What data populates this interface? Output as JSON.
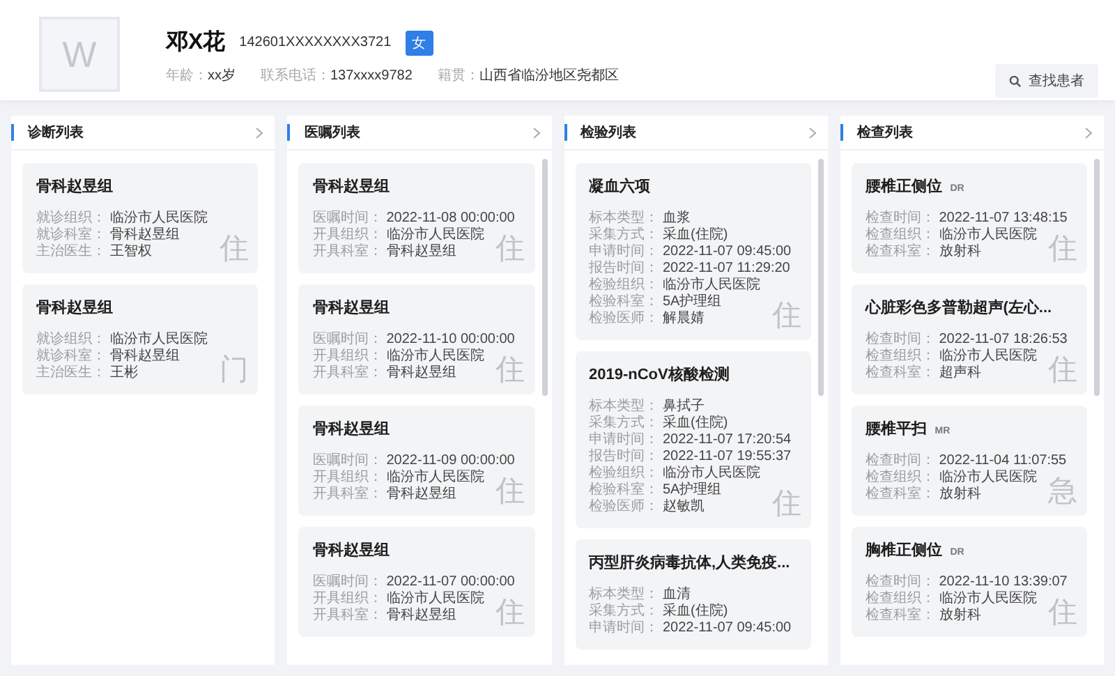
{
  "patient": {
    "avatar_letter": "W",
    "name": "邓X花",
    "id_number": "142601XXXXXXXX3721",
    "gender": "女",
    "info": [
      {
        "label": "年龄：",
        "value": "xx岁"
      },
      {
        "label": "联系电话：",
        "value": "137xxxx9782"
      },
      {
        "label": "籍贯：",
        "value": "山西省临汾地区尧都区"
      }
    ],
    "search_button": "查找患者"
  },
  "panels": [
    {
      "title": "诊断列表",
      "scrollable": false,
      "cards": [
        {
          "title": "骨科赵昱组",
          "badge": "住",
          "fields": [
            {
              "label": "就诊组织：",
              "value": "临汾市人民医院"
            },
            {
              "label": "就诊科室：",
              "value": "骨科赵昱组"
            },
            {
              "label": "主治医生：",
              "value": "王智权"
            }
          ]
        },
        {
          "title": "骨科赵昱组",
          "badge": "门",
          "fields": [
            {
              "label": "就诊组织：",
              "value": "临汾市人民医院"
            },
            {
              "label": "就诊科室：",
              "value": "骨科赵昱组"
            },
            {
              "label": "主治医生：",
              "value": "王彬"
            }
          ]
        }
      ]
    },
    {
      "title": "医嘱列表",
      "scrollable": true,
      "cards": [
        {
          "title": "骨科赵昱组",
          "badge": "住",
          "fields": [
            {
              "label": "医嘱时间：",
              "value": "2022-11-08 00:00:00"
            },
            {
              "label": "开具组织：",
              "value": "临汾市人民医院"
            },
            {
              "label": "开具科室：",
              "value": "骨科赵昱组"
            }
          ]
        },
        {
          "title": "骨科赵昱组",
          "badge": "住",
          "fields": [
            {
              "label": "医嘱时间：",
              "value": "2022-11-10 00:00:00"
            },
            {
              "label": "开具组织：",
              "value": "临汾市人民医院"
            },
            {
              "label": "开具科室：",
              "value": "骨科赵昱组"
            }
          ]
        },
        {
          "title": "骨科赵昱组",
          "badge": "住",
          "fields": [
            {
              "label": "医嘱时间：",
              "value": "2022-11-09 00:00:00"
            },
            {
              "label": "开具组织：",
              "value": "临汾市人民医院"
            },
            {
              "label": "开具科室：",
              "value": "骨科赵昱组"
            }
          ]
        },
        {
          "title": "骨科赵昱组",
          "badge": "住",
          "fields": [
            {
              "label": "医嘱时间：",
              "value": "2022-11-07 00:00:00"
            },
            {
              "label": "开具组织：",
              "value": "临汾市人民医院"
            },
            {
              "label": "开具科室：",
              "value": "骨科赵昱组"
            }
          ]
        }
      ]
    },
    {
      "title": "检验列表",
      "scrollable": true,
      "cards": [
        {
          "title": "凝血六项",
          "badge": "住",
          "fields": [
            {
              "label": "标本类型：",
              "value": "血浆"
            },
            {
              "label": "采集方式：",
              "value": "采血(住院)"
            },
            {
              "label": "申请时间：",
              "value": "2022-11-07 09:45:00"
            },
            {
              "label": "报告时间：",
              "value": "2022-11-07 11:29:20"
            },
            {
              "label": "检验组织：",
              "value": "临汾市人民医院"
            },
            {
              "label": "检验科室：",
              "value": "5A护理组"
            },
            {
              "label": "检验医师：",
              "value": "解晨婧"
            }
          ]
        },
        {
          "title": "2019-nCoV核酸检测",
          "badge": "住",
          "fields": [
            {
              "label": "标本类型：",
              "value": "鼻拭子"
            },
            {
              "label": "采集方式：",
              "value": "采血(住院)"
            },
            {
              "label": "申请时间：",
              "value": "2022-11-07 17:20:54"
            },
            {
              "label": "报告时间：",
              "value": "2022-11-07 19:55:37"
            },
            {
              "label": "检验组织：",
              "value": "临汾市人民医院"
            },
            {
              "label": "检验科室：",
              "value": "5A护理组"
            },
            {
              "label": "检验医师：",
              "value": "赵敏凯"
            }
          ]
        },
        {
          "title": "丙型肝炎病毒抗体,人类免疫...",
          "fields": [
            {
              "label": "标本类型：",
              "value": "血清"
            },
            {
              "label": "采集方式：",
              "value": "采血(住院)"
            },
            {
              "label": "申请时间：",
              "value": "2022-11-07 09:45:00"
            }
          ]
        }
      ]
    },
    {
      "title": "检查列表",
      "scrollable": true,
      "cards": [
        {
          "title": "腰椎正侧位",
          "tag": "DR",
          "badge": "住",
          "fields": [
            {
              "label": "检查时间：",
              "value": "2022-11-07 13:48:15"
            },
            {
              "label": "检查组织：",
              "value": "临汾市人民医院"
            },
            {
              "label": "检查科室：",
              "value": "放射科"
            }
          ]
        },
        {
          "title": "心脏彩色多普勒超声(左心...",
          "badge": "住",
          "fields": [
            {
              "label": "检查时间：",
              "value": "2022-11-07 18:26:53"
            },
            {
              "label": "检查组织：",
              "value": "临汾市人民医院"
            },
            {
              "label": "检查科室：",
              "value": "超声科"
            }
          ]
        },
        {
          "title": "腰椎平扫",
          "tag": "MR",
          "badge": "急",
          "fields": [
            {
              "label": "检查时间：",
              "value": "2022-11-04 11:07:55"
            },
            {
              "label": "检查组织：",
              "value": "临汾市人民医院"
            },
            {
              "label": "检查科室：",
              "value": "放射科"
            }
          ]
        },
        {
          "title": "胸椎正侧位",
          "tag": "DR",
          "badge": "住",
          "fields": [
            {
              "label": "检查时间：",
              "value": "2022-11-10 13:39:07"
            },
            {
              "label": "检查组织：",
              "value": "临汾市人民医院"
            },
            {
              "label": "检查科室：",
              "value": "放射科"
            }
          ]
        }
      ]
    }
  ]
}
